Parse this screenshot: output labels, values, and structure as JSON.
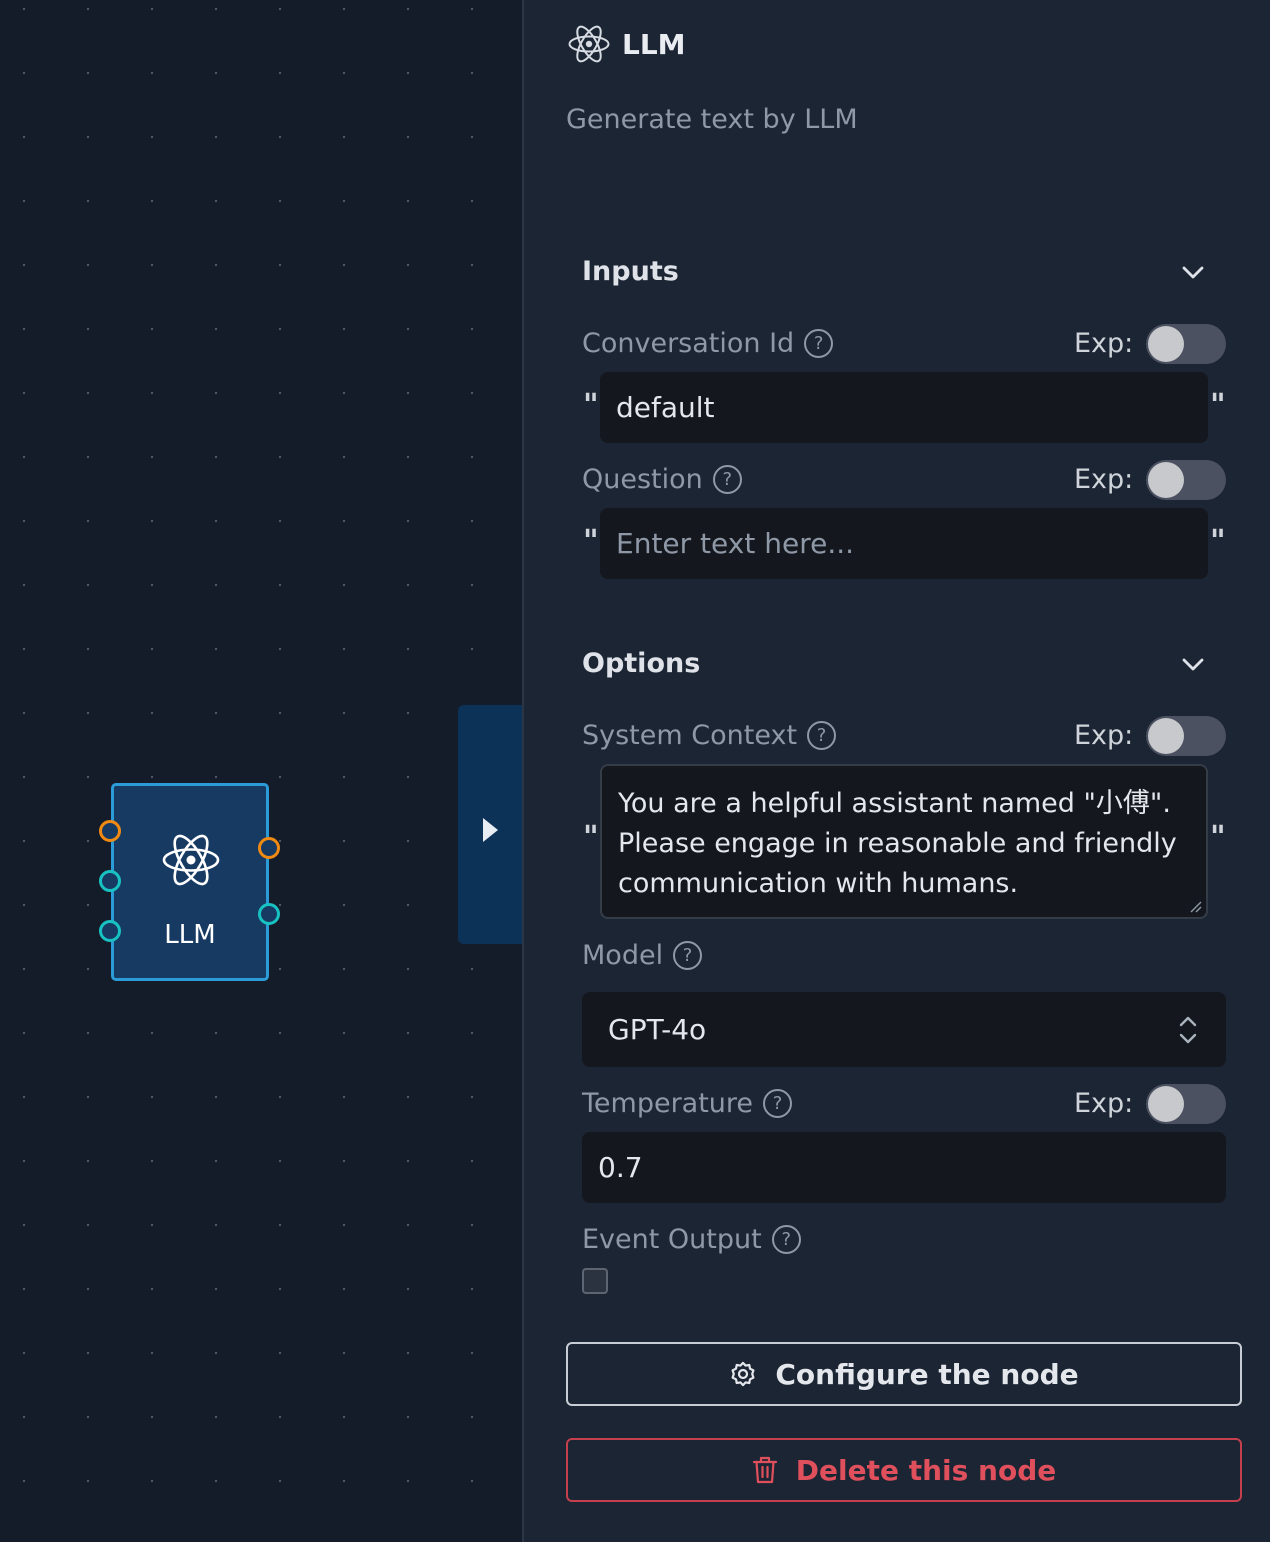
{
  "node": {
    "label": "LLM"
  },
  "panel": {
    "title": "LLM",
    "description": "Generate text by LLM"
  },
  "inputs": {
    "section_title": "Inputs",
    "conversation_id": {
      "label": "Conversation Id",
      "exp_label": "Exp:",
      "value": "default",
      "exp_enabled": false
    },
    "question": {
      "label": "Question",
      "exp_label": "Exp:",
      "value": "",
      "placeholder": "Enter text here...",
      "exp_enabled": false
    }
  },
  "options": {
    "section_title": "Options",
    "system_context": {
      "label": "System Context",
      "exp_label": "Exp:",
      "exp_enabled": false,
      "value": "You are a helpful assistant named \"小傅\". Please engage in reasonable and friendly communication with humans."
    },
    "model": {
      "label": "Model",
      "selected": "GPT-4o"
    },
    "temperature": {
      "label": "Temperature",
      "exp_label": "Exp:",
      "value": "0.7",
      "exp_enabled": false
    },
    "event_output": {
      "label": "Event Output",
      "checked": false
    }
  },
  "buttons": {
    "configure": "Configure the node",
    "delete": "Delete this node"
  },
  "glyphs": {
    "open_quote": "\"",
    "close_quote": "\"",
    "help": "?"
  },
  "colors": {
    "node_fill": "#173a63",
    "node_border": "#2c9cd8",
    "port_orange": "#f08a12",
    "port_teal": "#19c2c2",
    "delete_red": "#e04f5c"
  }
}
